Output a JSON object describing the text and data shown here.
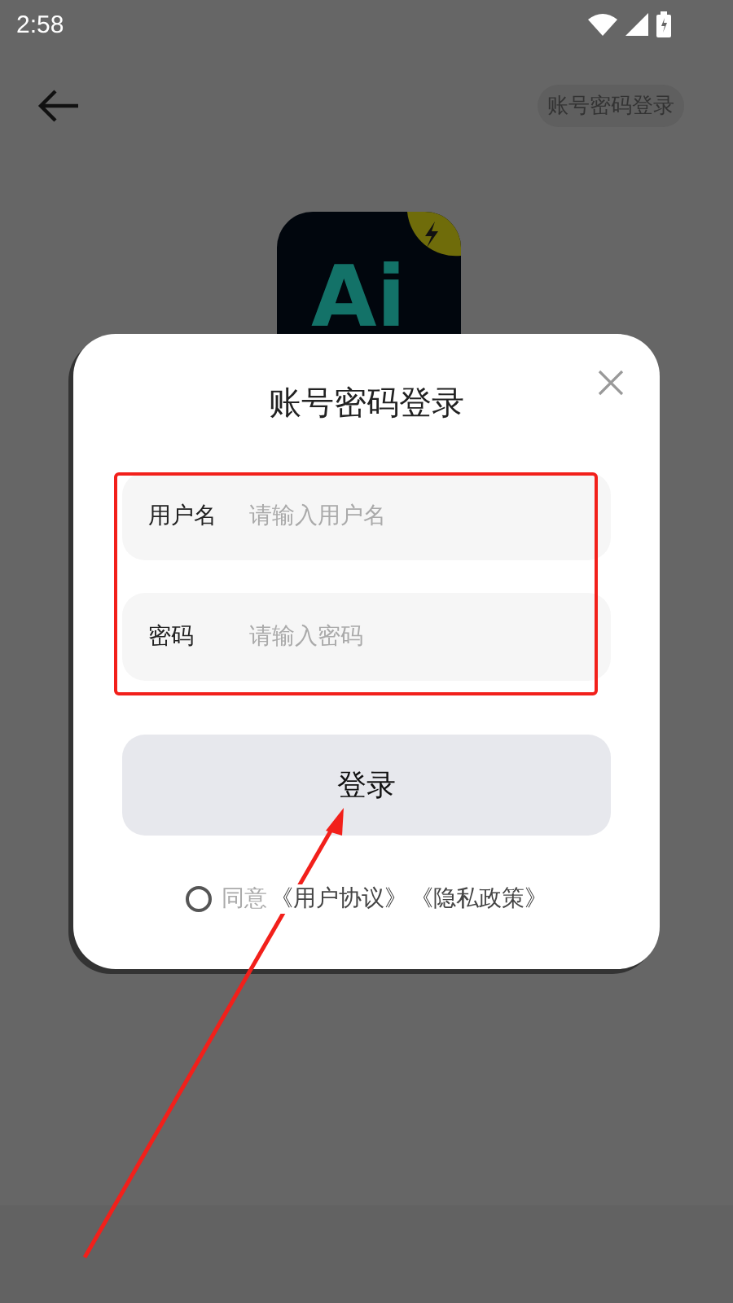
{
  "status_bar": {
    "time": "2:58"
  },
  "top_bar": {
    "mode_button": "账号密码登录"
  },
  "app_logo": {
    "text": "Ai"
  },
  "dialog": {
    "title": "账号密码登录",
    "fields": [
      {
        "label": "用户名",
        "placeholder": "请输入用户名"
      },
      {
        "label": "密码",
        "placeholder": "请输入密码"
      }
    ],
    "login_button": "登录",
    "agreement": {
      "checked": false,
      "text": "同意",
      "links": [
        "《用户协议》",
        "《隐私政策》"
      ]
    }
  }
}
